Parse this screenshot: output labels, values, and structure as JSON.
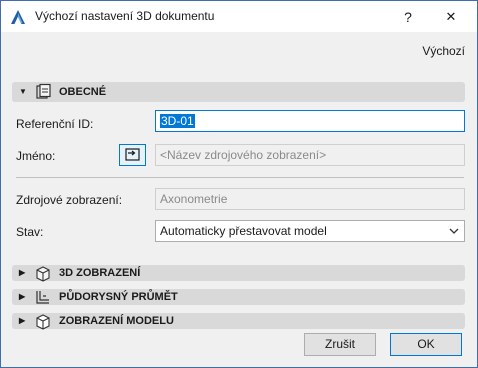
{
  "window": {
    "title": "Výchozí nastavení 3D dokumentu",
    "help_glyph": "?",
    "close_glyph": "✕"
  },
  "defaults_link": "Výchozí",
  "sections": {
    "general": {
      "label": "OBECNÉ",
      "expanded": true
    },
    "view3d": {
      "label": "3D ZOBRAZENÍ",
      "expanded": false
    },
    "floorplan": {
      "label": "PŮDORYSNÝ PRŮMĚT",
      "expanded": false
    },
    "modelview": {
      "label": "ZOBRAZENÍ MODELU",
      "expanded": false
    }
  },
  "form": {
    "reference_id_label": "Referenční ID:",
    "reference_id_value": "3D-01",
    "name_label": "Jméno:",
    "name_placeholder": "<Název zdrojového zobrazení>",
    "source_view_label": "Zdrojové zobrazení:",
    "source_view_value": "Axonometrie",
    "status_label": "Stav:",
    "status_value": "Automaticky přestavovat model"
  },
  "buttons": {
    "cancel": "Zrušit",
    "ok": "OK"
  },
  "colors": {
    "accent": "#0078d7",
    "section_bg": "#d9d9d9",
    "dialog_bg": "#f0f0f0"
  },
  "icons": {
    "app": "archicad-icon",
    "general": "document-settings-icon",
    "view3d": "3d-box-icon",
    "floorplan": "floorplan-icon",
    "modelview": "model-cube-icon",
    "link": "link-source-icon"
  }
}
